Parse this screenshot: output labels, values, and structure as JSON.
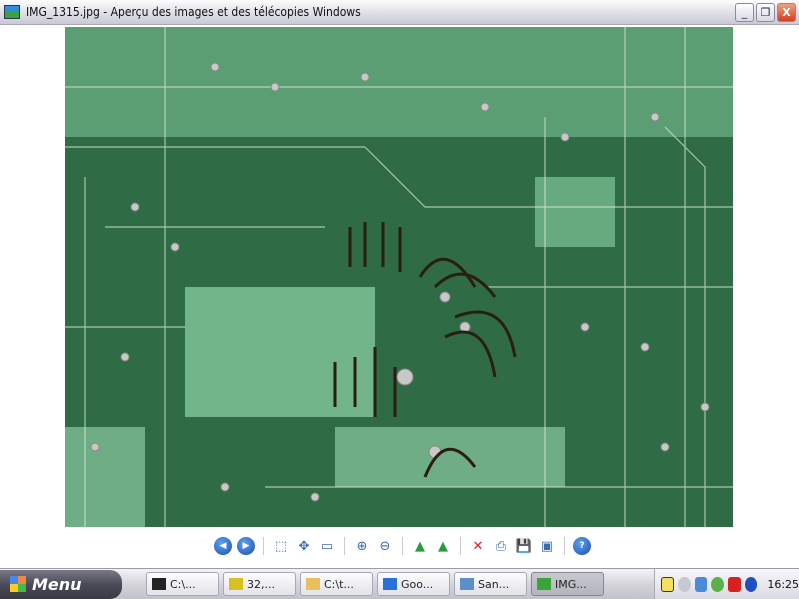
{
  "window": {
    "title": "IMG_1315.jpg - Aperçu des images et des télécopies Windows",
    "minimize": "_",
    "restore": "❐",
    "close": "X"
  },
  "toolbar": [
    {
      "name": "previous-image-button",
      "glyph": "◀"
    },
    {
      "name": "next-image-button",
      "glyph": "▶"
    },
    {
      "sep": true
    },
    {
      "name": "best-fit-button",
      "glyph": "⬚"
    },
    {
      "name": "actual-size-button",
      "glyph": "✥"
    },
    {
      "name": "slideshow-button",
      "glyph": "▭"
    },
    {
      "sep": true
    },
    {
      "name": "zoom-in-button",
      "glyph": "⊕"
    },
    {
      "name": "zoom-out-button",
      "glyph": "⊖"
    },
    {
      "sep": true
    },
    {
      "name": "rotate-clockwise-button",
      "glyph": "▲"
    },
    {
      "name": "rotate-counterclockwise-button",
      "glyph": "▲"
    },
    {
      "sep": true
    },
    {
      "name": "delete-button",
      "glyph": "✕"
    },
    {
      "name": "print-button",
      "glyph": "⎙"
    },
    {
      "name": "save-button",
      "glyph": "💾"
    },
    {
      "name": "open-editor-button",
      "glyph": "▣"
    },
    {
      "sep": true
    },
    {
      "name": "help-button",
      "glyph": "?"
    }
  ],
  "colors": {
    "accent": "#1a4fb0",
    "delete": "#e02020",
    "pcb": "#2e6a43"
  },
  "taskbar": {
    "start_label": "Menu",
    "tasks": [
      {
        "label": "C:\\...",
        "icon": "#222"
      },
      {
        "label": "32,...",
        "icon": "#d8c020"
      },
      {
        "label": "C:\\t...",
        "icon": "#e8c060"
      },
      {
        "label": "Goo...",
        "icon": "#2a70d8"
      },
      {
        "label": "San...",
        "icon": "#5a90c8"
      },
      {
        "label": "IMG...",
        "icon": "#3aa33a",
        "active": true
      }
    ],
    "clock": "16:25"
  }
}
